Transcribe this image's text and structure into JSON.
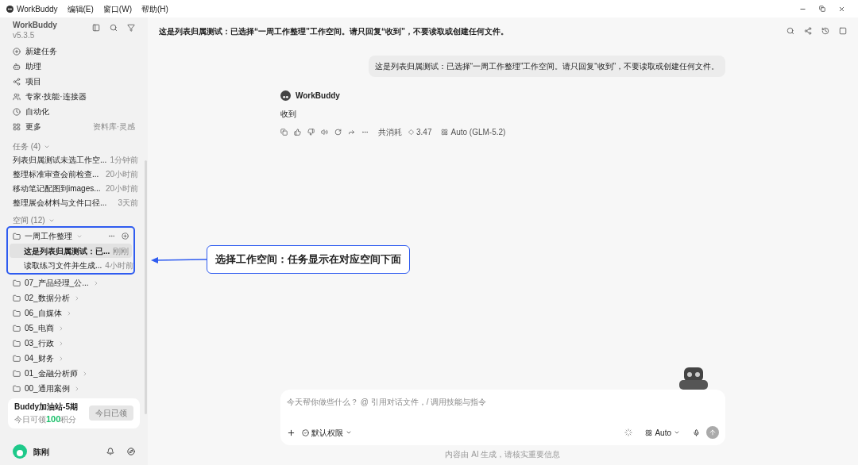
{
  "menu_bar": {
    "app_name": "WorkBuddy",
    "items": [
      "编辑(E)",
      "窗口(W)",
      "帮助(H)"
    ]
  },
  "sidebar": {
    "app_name": "WorkBuddy",
    "version": "v5.3.5",
    "nav": [
      {
        "kind": "new",
        "label": "新建任务"
      },
      {
        "kind": "assistant",
        "label": "助理"
      },
      {
        "kind": "project",
        "label": "项目"
      },
      {
        "kind": "experts",
        "label": "专家·技能·连接器"
      },
      {
        "kind": "auto",
        "label": "自动化"
      },
      {
        "kind": "more",
        "label": "更多",
        "hint": "资料库·灵感"
      }
    ],
    "tasks_header": {
      "label": "任务",
      "count": "(4)"
    },
    "tasks": [
      {
        "title": "列表归属测试未选工作空...",
        "time": "1分钟前"
      },
      {
        "title": "整理标准审查会前检查...",
        "time": "20小时前"
      },
      {
        "title": "移动笔记配图到images...",
        "time": "20小时前"
      },
      {
        "title": "整理展会材料与文件口径...",
        "time": "3天前"
      }
    ],
    "spaces_header": {
      "label": "空间",
      "count": "(12)"
    },
    "spaces": [
      {
        "name": "一周工作整理",
        "expanded": true,
        "tasks": [
          {
            "title": "这是列表归属测试：已...",
            "time": "刚刚",
            "selected": true
          },
          {
            "title": "读取练习文件并生成...",
            "time": "4小时前",
            "selected": false
          }
        ]
      },
      {
        "name": "07_产品经理_公...",
        "expanded": false
      },
      {
        "name": "02_数据分析",
        "expanded": false
      },
      {
        "name": "06_自媒体",
        "expanded": false
      },
      {
        "name": "05_电商",
        "expanded": false
      },
      {
        "name": "03_行政",
        "expanded": false
      },
      {
        "name": "04_财务",
        "expanded": false
      },
      {
        "name": "01_金融分析师",
        "expanded": false
      },
      {
        "name": "00_通用案例",
        "expanded": false
      }
    ],
    "promo": {
      "title": "Buddy加油站-5期",
      "prefix": "今日可领",
      "points": "100",
      "suffix": "积分",
      "button": "今日已领"
    },
    "user": {
      "name": "陈刚"
    }
  },
  "main": {
    "title": "这是列表归属测试：已选择“一周工作整理”工作空间。请只回复“收到”，不要读取或创建任何文件。",
    "user_message": "这是列表归属测试：已选择“一周工作整理”工作空间。请只回复“收到”，不要读取或创建任何文件。",
    "assistant": {
      "name": "WorkBuddy",
      "reply": "收到",
      "cost_label": "共消耗",
      "cost": "3.47",
      "model": "Auto (GLM-5.2)"
    },
    "composer": {
      "placeholder": "今天帮你做些什么？ @ 引用对话文件，/ 调用技能与指令",
      "permission": "默认权限",
      "model": "Auto"
    },
    "footer": "内容由 AI 生成，请核实重要信息"
  },
  "annotation": {
    "text": "选择工作空间：任务显示在对应空间下面"
  }
}
